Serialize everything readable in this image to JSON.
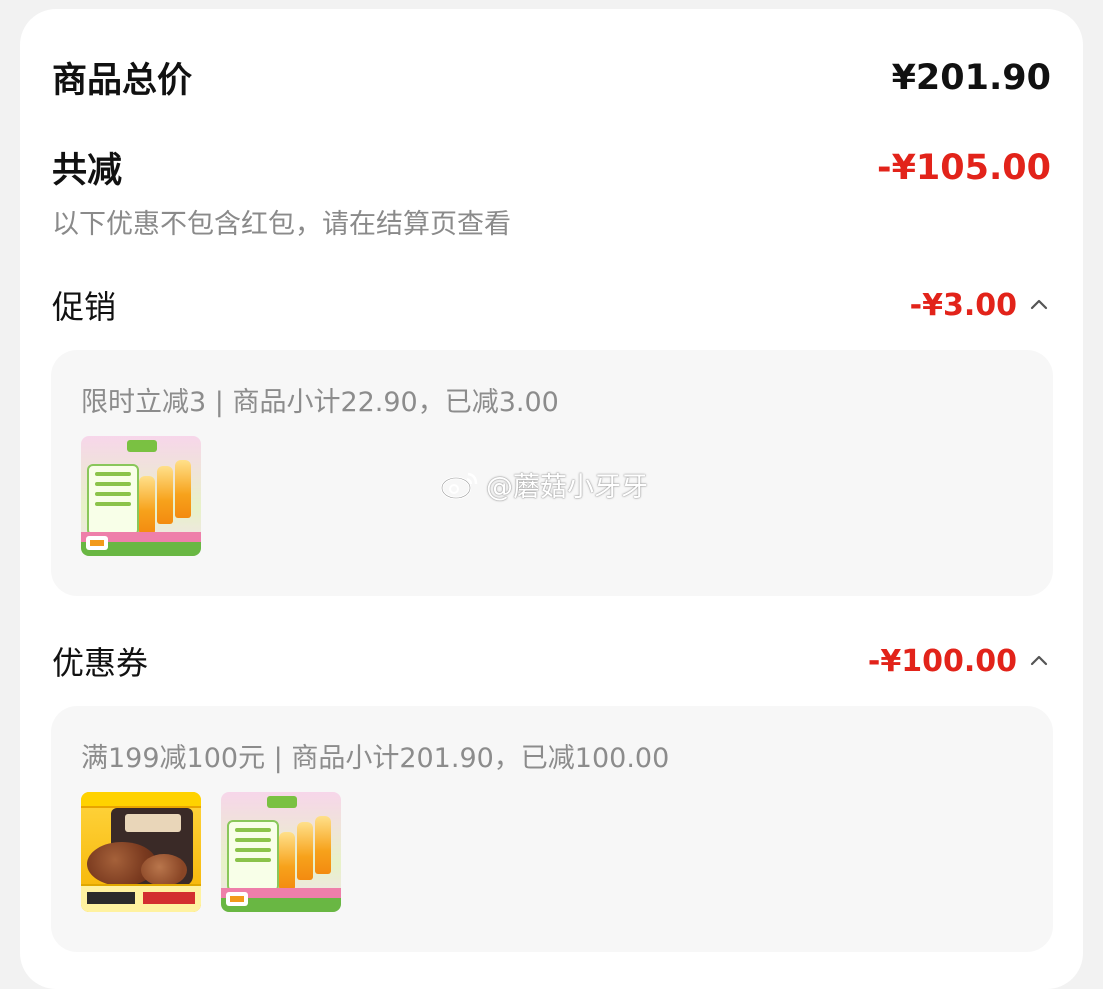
{
  "summary": {
    "total_label": "商品总价",
    "total_value": "¥201.90",
    "reduction_label": "共减",
    "reduction_value": "-¥105.00",
    "note": "以下优惠不包含红包，请在结算页查看"
  },
  "promotion": {
    "label": "促销",
    "value": "-¥3.00",
    "detail": "限时立减3 | 商品小计22.90，已减3.00",
    "products": [
      {
        "icon": "juice-product-thumbnail"
      }
    ]
  },
  "coupon": {
    "label": "优惠券",
    "value": "-¥100.00",
    "detail": "满199减100元 | 商品小计201.90，已减100.00",
    "products": [
      {
        "icon": "beef-product-thumbnail"
      },
      {
        "icon": "juice-product-thumbnail"
      }
    ]
  },
  "watermark": {
    "text": "@蘑菇小牙牙",
    "icon": "weibo-icon"
  },
  "colors": {
    "accent_red": "#e2231a",
    "panel_bg": "#f7f7f7",
    "page_bg": "#f2f2f2"
  }
}
